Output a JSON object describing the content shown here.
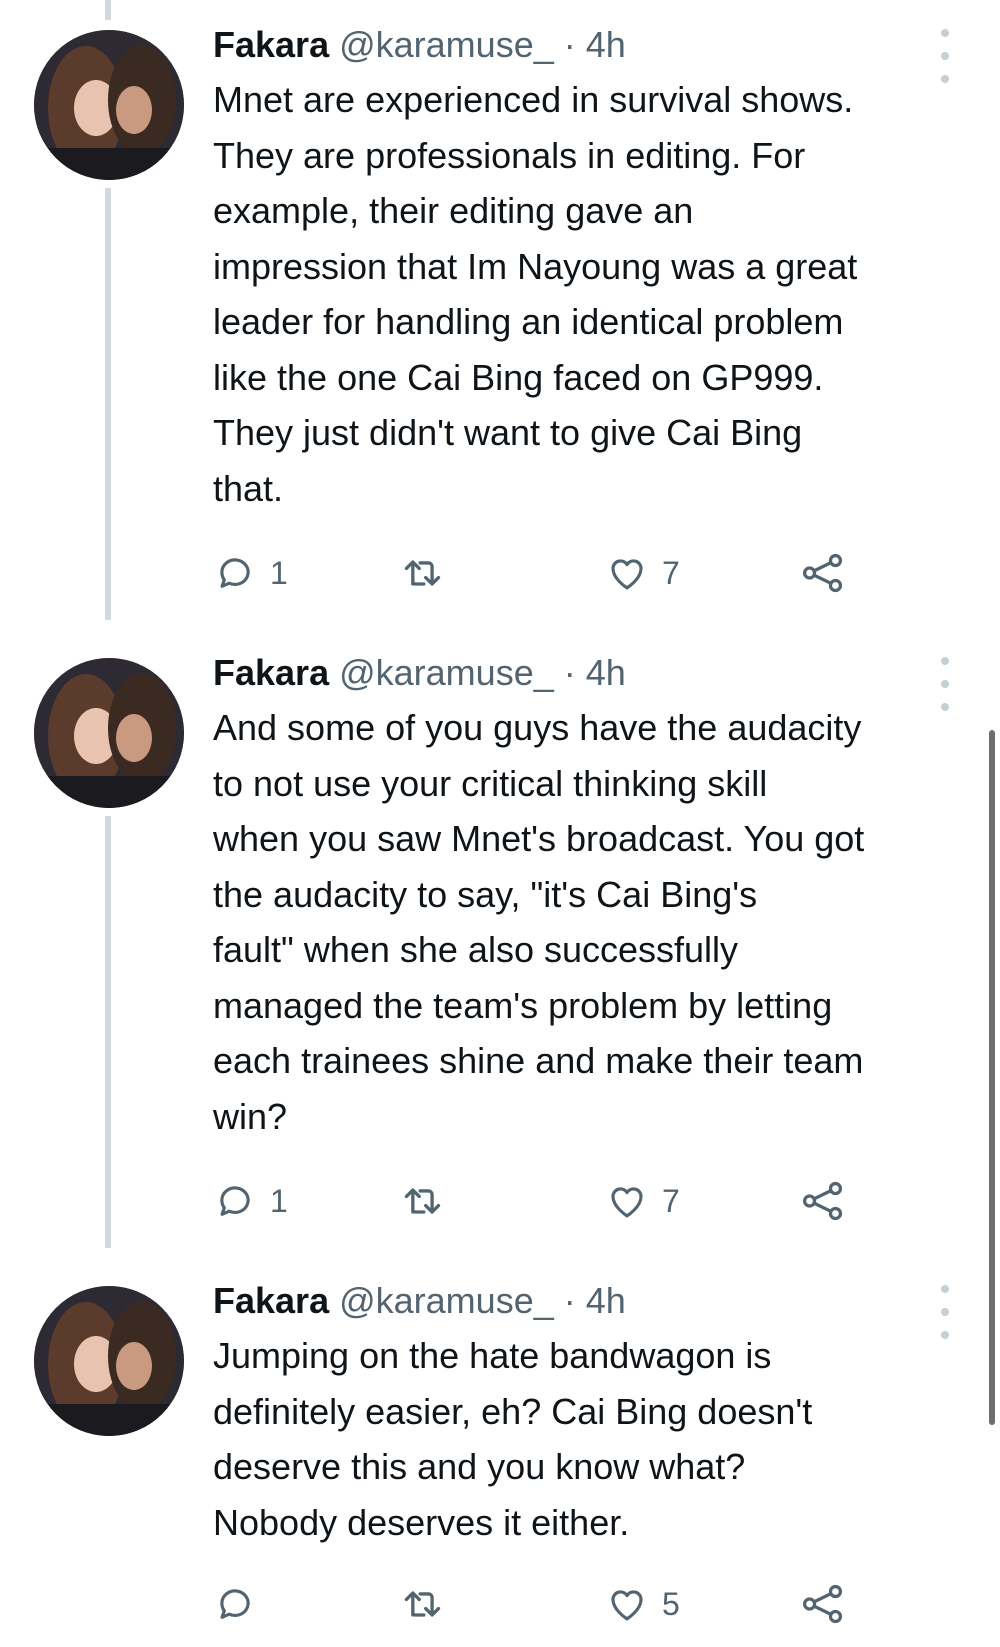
{
  "tweets": [
    {
      "author_name": "Fakara",
      "author_handle": "@karamuse_",
      "separator": "·",
      "time": "4h",
      "text": "Mnet are experienced in survival shows.\nThey are professionals in editing. For\nexample, their editing gave an\nimpression that Im Nayoung was a great\nleader for handling an identical problem\nlike the one Cai Bing faced on GP999.\nThey just didn't want to give Cai Bing\nthat.",
      "reply_count": "1",
      "like_count": "7"
    },
    {
      "author_name": "Fakara",
      "author_handle": "@karamuse_",
      "separator": "·",
      "time": "4h",
      "text": "And some of you guys have the audacity\nto not use your critical thinking skill\nwhen you saw Mnet's broadcast. You got\nthe audacity to say, \"it's Cai Bing's\nfault\" when she also successfully\nmanaged the team's problem by letting\neach trainees shine and make their team\nwin?",
      "reply_count": "1",
      "like_count": "7"
    },
    {
      "author_name": "Fakara",
      "author_handle": "@karamuse_",
      "separator": "·",
      "time": "4h",
      "text": "Jumping on the hate bandwagon is\ndefinitely easier, eh? Cai Bing doesn't\ndeserve this and you know what?\nNobody deserves it either.",
      "reply_count": "",
      "like_count": "5"
    }
  ],
  "icons": {
    "reply": "reply-icon",
    "retweet": "retweet-icon",
    "like": "heart-icon",
    "share": "share-icon",
    "more": "more-options-icon"
  },
  "colors": {
    "text_primary": "#0f1419",
    "text_secondary": "#536471",
    "thread_line": "#cfd9de",
    "icon_gray": "#536471"
  }
}
